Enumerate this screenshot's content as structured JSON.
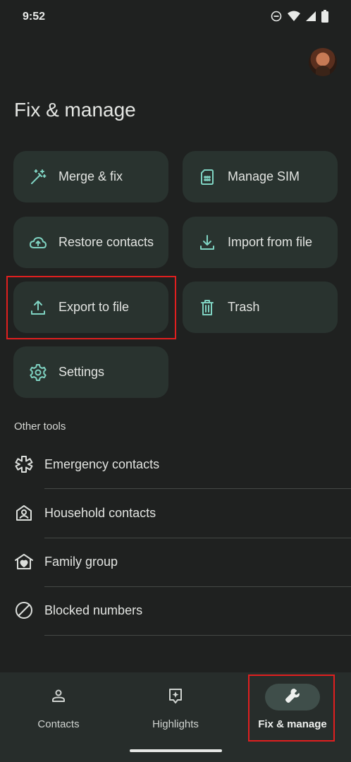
{
  "status_bar": {
    "time": "9:52"
  },
  "header": {
    "title": "Fix & manage"
  },
  "cards": [
    {
      "label": "Merge & fix",
      "icon": "magic-wand-icon"
    },
    {
      "label": "Manage SIM",
      "icon": "sim-card-icon"
    },
    {
      "label": "Restore contacts",
      "icon": "cloud-restore-icon"
    },
    {
      "label": "Import from file",
      "icon": "download-icon"
    },
    {
      "label": "Export to file",
      "icon": "upload-icon"
    },
    {
      "label": "Trash",
      "icon": "trash-icon"
    },
    {
      "label": "Settings",
      "icon": "gear-icon"
    }
  ],
  "other_tools": {
    "label": "Other tools",
    "items": [
      {
        "label": "Emergency contacts",
        "icon": "emergency-icon"
      },
      {
        "label": "Household contacts",
        "icon": "household-icon"
      },
      {
        "label": "Family group",
        "icon": "family-home-icon"
      },
      {
        "label": "Blocked numbers",
        "icon": "block-icon"
      }
    ]
  },
  "bottom_nav": [
    {
      "label": "Contacts",
      "icon": "person-icon",
      "active": false
    },
    {
      "label": "Highlights",
      "icon": "highlights-icon",
      "active": false
    },
    {
      "label": "Fix & manage",
      "icon": "wrench-icon",
      "active": true
    }
  ],
  "colors": {
    "accent": "#7fd3c2",
    "background": "#1f2120",
    "card": "#29332f",
    "highlight_box": "#e01f1f"
  }
}
